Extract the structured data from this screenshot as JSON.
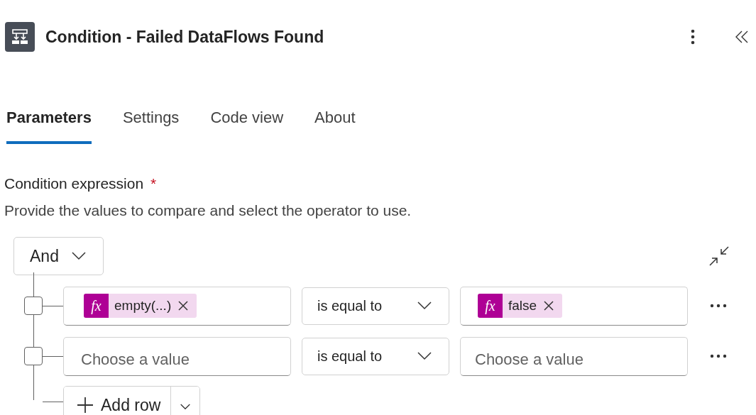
{
  "header": {
    "title": "Condition - Failed DataFlows Found"
  },
  "tabs": [
    {
      "label": "Parameters",
      "selected": true
    },
    {
      "label": "Settings",
      "selected": false
    },
    {
      "label": "Code view",
      "selected": false
    },
    {
      "label": "About",
      "selected": false
    }
  ],
  "field": {
    "label": "Condition expression",
    "required": true,
    "required_mark": "*",
    "description": "Provide the values to compare and select the operator to use."
  },
  "group": {
    "operator": "And",
    "rows": [
      {
        "checked": false,
        "left": {
          "kind": "token",
          "fx": "fx",
          "text": "empty(...)"
        },
        "operator": "is equal to",
        "right": {
          "kind": "token",
          "fx": "fx",
          "text": "false"
        }
      },
      {
        "checked": false,
        "left": {
          "kind": "placeholder",
          "text": "Choose a value"
        },
        "operator": "is equal to",
        "right": {
          "kind": "placeholder",
          "text": "Choose a value"
        }
      }
    ],
    "add_row": "Add row"
  }
}
